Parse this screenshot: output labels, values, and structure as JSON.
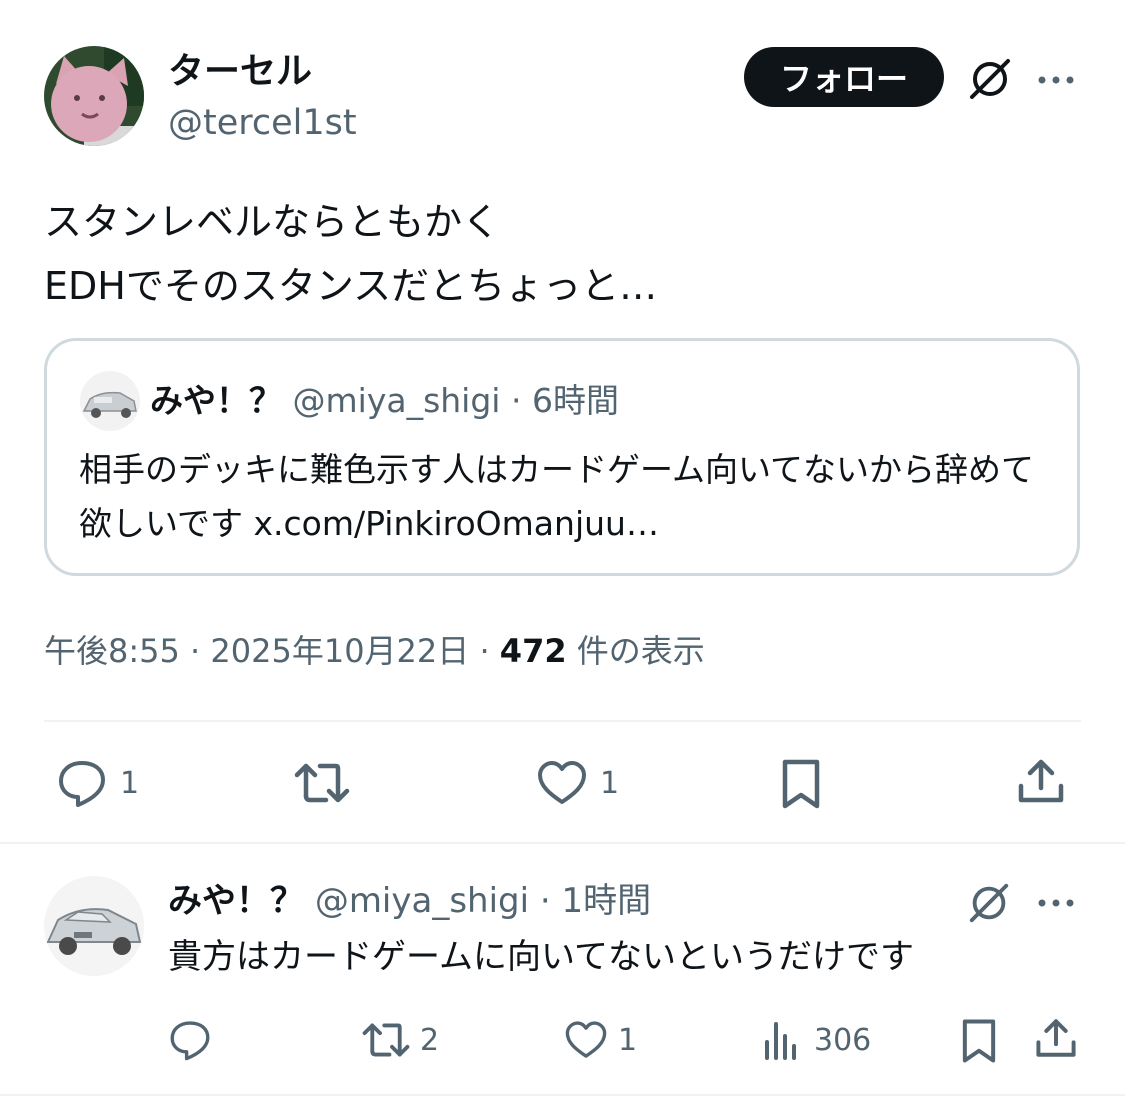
{
  "main_tweet": {
    "display_name": "ターセル",
    "handle": "@tercel1st",
    "follow_label": "フォロー",
    "text_line1": "スタンレベルならともかく",
    "text_line2": "EDHでそのスタンスだとちょっと…",
    "time": "午後8:55",
    "date": "2025年10月22日",
    "views_count": "472",
    "views_label": "件の表示",
    "separator": "·",
    "reply_count": "1",
    "like_count": "1"
  },
  "quoted_tweet": {
    "display_name": "みや！？",
    "handle": "@miya_shigi",
    "separator": "·",
    "time_ago": "6時間",
    "text": "相手のデッキに難色示す人はカードゲーム向いてないから辞めて欲しいです x.com/PinkiroOmanjuu…"
  },
  "reply": {
    "display_name": "みや！？",
    "handle": "@miya_shigi",
    "separator": "·",
    "time_ago": "1時間",
    "text": "貴方はカードゲームに向いてないというだけです",
    "retweet_count": "2",
    "like_count": "1",
    "views_count": "306"
  },
  "icons": {
    "reply": "comment-icon",
    "retweet": "retweet-icon",
    "like": "heart-icon",
    "bookmark": "bookmark-icon",
    "share": "share-icon",
    "views": "analytics-icon",
    "grok": "grok-icon",
    "more": "more-icon"
  },
  "colors": {
    "text": "#0f1419",
    "muted": "#536471",
    "border": "#cfd9de",
    "divider": "#eff3f4",
    "follow_bg": "#0f1419"
  }
}
